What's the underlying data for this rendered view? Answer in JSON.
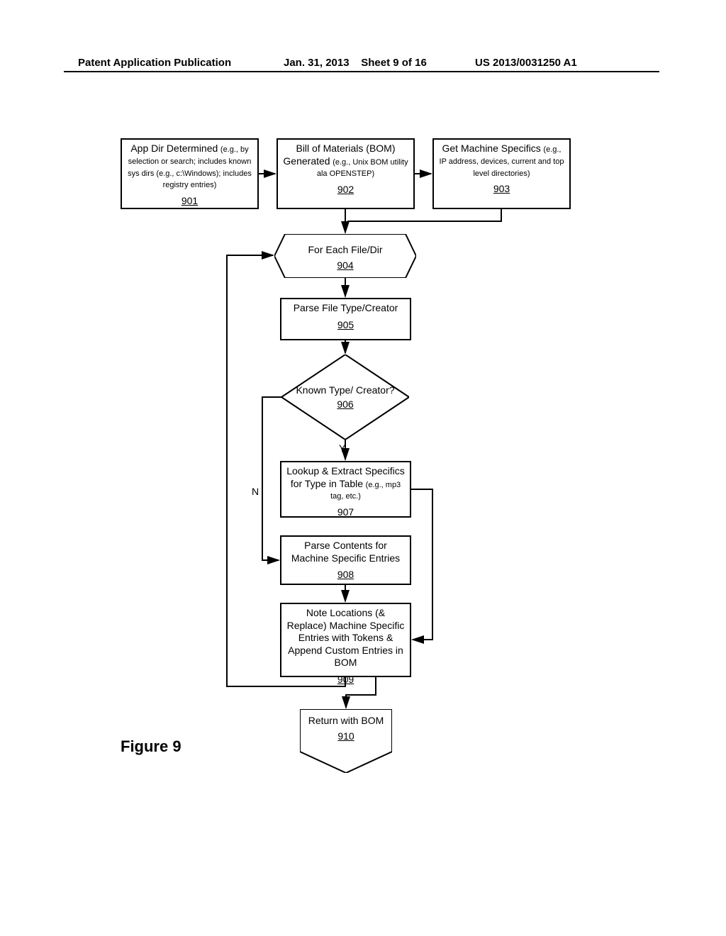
{
  "header": {
    "left": "Patent Application Publication",
    "mid_date": "Jan. 31, 2013",
    "mid_sheet": "Sheet 9 of 16",
    "right": "US 2013/0031250 A1"
  },
  "figure_label": "Figure 9",
  "nodes": {
    "n901": {
      "title": "App Dir Determined",
      "sub": "(e.g., by selection or search; includes known sys dirs (e.g., c:\\Windows); includes registry entries)",
      "num": "901"
    },
    "n902": {
      "title": "Bill of Materials (BOM) Generated",
      "sub": "(e.g., Unix BOM utility ala OPENSTEP)",
      "num": "902"
    },
    "n903": {
      "title": "Get Machine Specifics",
      "sub": "(e.g., IP address, devices, current and top level directories)",
      "num": "903"
    },
    "n904": {
      "title": "For Each File/Dir",
      "num": "904"
    },
    "n905": {
      "title": "Parse File Type/Creator",
      "num": "905"
    },
    "n906": {
      "title": "Known Type/ Creator?",
      "num": "906"
    },
    "n907": {
      "title": "Lookup & Extract Specifics for Type in Table",
      "sub": "(e.g., mp3 tag, etc.)",
      "num": "907"
    },
    "n908": {
      "title": "Parse Contents for Machine Specific Entries",
      "num": "908"
    },
    "n909": {
      "title": "Note Locations (& Replace) Machine Specific Entries with Tokens & Append Custom Entries in BOM",
      "num": "909"
    },
    "n910": {
      "title": "Return with BOM",
      "num": "910"
    }
  },
  "edge_labels": {
    "yes": "Y",
    "no": "N"
  },
  "chart_data": {
    "type": "flowchart",
    "title": "Figure 9",
    "nodes": [
      {
        "id": "901",
        "shape": "process",
        "text": "App Dir Determined (e.g., by selection or search; includes known sys dirs (e.g., c:\\Windows); includes registry entries)"
      },
      {
        "id": "902",
        "shape": "process",
        "text": "Bill of Materials (BOM) Generated (e.g., Unix BOM utility ala OPENSTEP)"
      },
      {
        "id": "903",
        "shape": "process",
        "text": "Get Machine Specifics (e.g., IP address, devices, current and top level directories)"
      },
      {
        "id": "904",
        "shape": "loop-hex",
        "text": "For Each File/Dir"
      },
      {
        "id": "905",
        "shape": "process",
        "text": "Parse File Type/Creator"
      },
      {
        "id": "906",
        "shape": "decision",
        "text": "Known Type/Creator?"
      },
      {
        "id": "907",
        "shape": "process",
        "text": "Lookup & Extract Specifics for Type in Table (e.g., mp3 tag, etc.)"
      },
      {
        "id": "908",
        "shape": "process",
        "text": "Parse Contents for Machine Specific Entries"
      },
      {
        "id": "909",
        "shape": "process",
        "text": "Note Locations (& Replace) Machine Specific Entries with Tokens & Append Custom Entries in BOM"
      },
      {
        "id": "910",
        "shape": "terminator",
        "text": "Return with BOM"
      }
    ],
    "edges": [
      {
        "from": "901",
        "to": "902"
      },
      {
        "from": "902",
        "to": "903"
      },
      {
        "from": "903",
        "to": "904"
      },
      {
        "from": "902",
        "to": "904"
      },
      {
        "from": "904",
        "to": "905"
      },
      {
        "from": "905",
        "to": "906"
      },
      {
        "from": "906",
        "to": "907",
        "label": "Y"
      },
      {
        "from": "906",
        "to": "908",
        "label": "N"
      },
      {
        "from": "907",
        "to": "909"
      },
      {
        "from": "908",
        "to": "909"
      },
      {
        "from": "909",
        "to": "904",
        "note": "loop back"
      },
      {
        "from": "909",
        "to": "910"
      }
    ]
  }
}
